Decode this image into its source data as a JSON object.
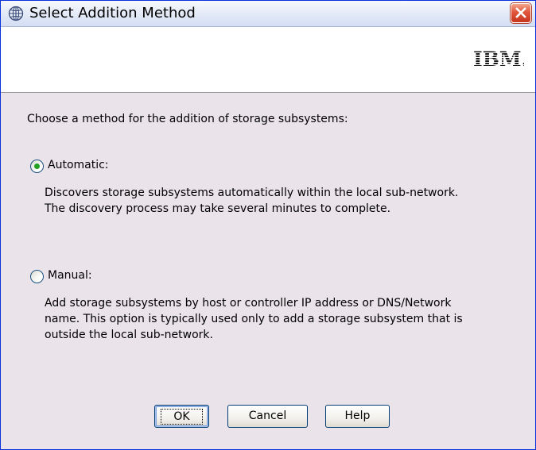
{
  "window": {
    "title": "Select Addition Method",
    "title_icon": "globe-icon",
    "close_icon": "close-icon"
  },
  "banner": {
    "logo_text": "IBM."
  },
  "main": {
    "instruction": "Choose a method for the addition of storage subsystems:",
    "options": [
      {
        "label": "Automatic:",
        "selected": true,
        "description": [
          "Discovers storage subsystems automatically within the local sub-network.",
          "The discovery process may take several minutes to complete."
        ]
      },
      {
        "label": "Manual:",
        "selected": false,
        "description": [
          "Add storage subsystems by host or controller IP address or DNS/Network",
          "name. This option is typically used only to add a storage subsystem that is",
          "outside the local sub-network."
        ]
      }
    ]
  },
  "buttons": {
    "ok": "OK",
    "cancel": "Cancel",
    "help": "Help"
  },
  "colors": {
    "accent": "#0831d9",
    "close_button": "#e0553c",
    "radio_dot": "#21a121",
    "dialog_bg": "#eae3ea"
  }
}
